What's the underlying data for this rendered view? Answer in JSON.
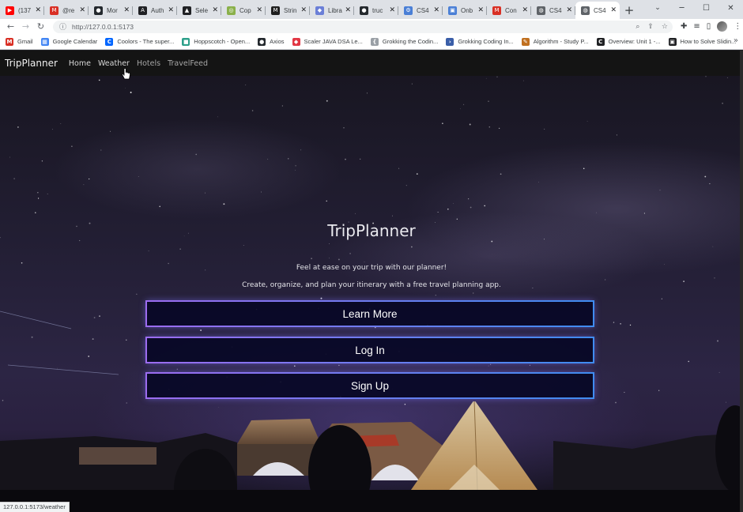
{
  "browser": {
    "tabs": [
      {
        "label": "(137",
        "icon": "youtube-icon",
        "color": "#ff0000",
        "glyph": "▶"
      },
      {
        "label": "@re",
        "icon": "gmail-icon",
        "color": "#d93025",
        "glyph": "M"
      },
      {
        "label": "Mor",
        "icon": "github-icon",
        "color": "#24292e",
        "glyph": "●"
      },
      {
        "label": "Auth",
        "icon": "auth-icon",
        "color": "#202124",
        "glyph": "A"
      },
      {
        "label": "Sele",
        "icon": "selenium-icon",
        "color": "#202124",
        "glyph": "▲"
      },
      {
        "label": "Cop",
        "icon": "copy-icon",
        "color": "#8ab04a",
        "glyph": "◎"
      },
      {
        "label": "Strin",
        "icon": "string-icon",
        "color": "#1f1f1f",
        "glyph": "M"
      },
      {
        "label": "Libra",
        "icon": "library-icon",
        "color": "#6b7fd7",
        "glyph": "◆"
      },
      {
        "label": "truc",
        "icon": "github-icon",
        "color": "#24292e",
        "glyph": "●"
      },
      {
        "label": "CS4",
        "icon": "cs-icon",
        "color": "#4a7fd6",
        "glyph": "⚙"
      },
      {
        "label": "Onb",
        "icon": "onboard-icon",
        "color": "#4a7fd6",
        "glyph": "▣"
      },
      {
        "label": "Con",
        "icon": "gmail-icon",
        "color": "#d93025",
        "glyph": "M"
      },
      {
        "label": "CS4",
        "icon": "globe-icon",
        "color": "#5f6368",
        "glyph": "◍"
      },
      {
        "label": "CS4",
        "icon": "globe-icon",
        "color": "#5f6368",
        "glyph": "◍",
        "active": true
      }
    ],
    "new_tab": "+",
    "address": "http://127.0.0.1:5173",
    "bookmarks": [
      {
        "label": "Gmail",
        "icon": "gmail-icon",
        "color": "#d93025",
        "glyph": "M"
      },
      {
        "label": "Google Calendar",
        "icon": "calendar-icon",
        "color": "#4285f4",
        "glyph": "▦"
      },
      {
        "label": "Coolors - The super...",
        "icon": "coolors-icon",
        "color": "#0066ff",
        "glyph": "C"
      },
      {
        "label": "Hoppscotch - Open...",
        "icon": "hoppscotch-icon",
        "color": "#2c9f8a",
        "glyph": "■"
      },
      {
        "label": "Axios",
        "icon": "github-icon",
        "color": "#24292e",
        "glyph": "●"
      },
      {
        "label": "Scaler JAVA DSA Le...",
        "icon": "scaler-icon",
        "color": "#e23744",
        "glyph": "◆"
      },
      {
        "label": "Grokking the Codin...",
        "icon": "grokking-icon",
        "color": "#9aa0a6",
        "glyph": "{"
      },
      {
        "label": "Grokking Coding In...",
        "icon": "terminal-icon",
        "color": "#3a5ea8",
        "glyph": "›"
      },
      {
        "label": "Algorithm - Study P...",
        "icon": "algorithm-icon",
        "color": "#c07020",
        "glyph": "✎"
      },
      {
        "label": "Overview: Unit 1 -...",
        "icon": "coursera-icon",
        "color": "#202124",
        "glyph": "C"
      },
      {
        "label": "How to Solve Slidin...",
        "icon": "video-icon",
        "color": "#202124",
        "glyph": "▣"
      }
    ],
    "status_url": "127.0.0.1:5173/weather"
  },
  "app": {
    "brand": "TripPlanner",
    "nav": [
      "Home",
      "Weather",
      "Hotels",
      "TravelFeed"
    ],
    "hero": {
      "title": "TripPlanner",
      "subtitle1": "Feel at ease on your trip with our planner!",
      "subtitle2": "Create, organize, and plan your itinerary with a free travel planning app."
    },
    "buttons": {
      "learn_more": "Learn More",
      "log_in": "Log In",
      "sign_up": "Sign Up"
    },
    "colors": {
      "navbar_bg": "#141414",
      "button_bg": "#080826",
      "button_border_start": "#9c6cf0",
      "button_border_end": "#3f8cf0"
    }
  }
}
